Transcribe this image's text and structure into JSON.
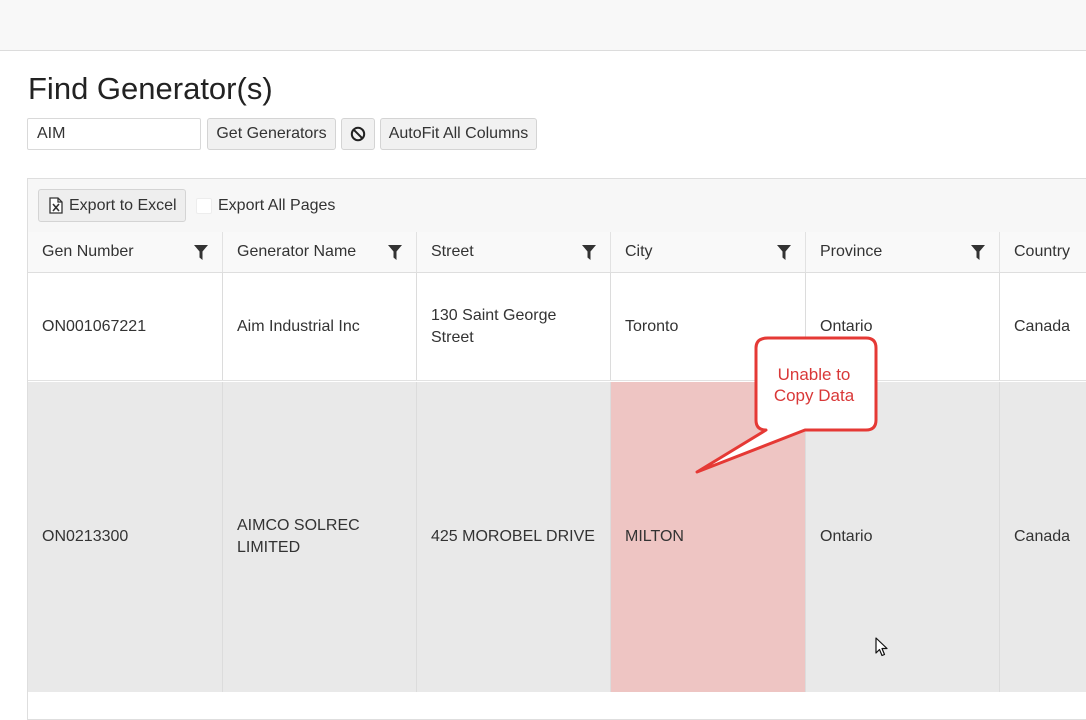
{
  "page": {
    "title": "Find Generator(s)"
  },
  "search": {
    "value": "AIM",
    "get_label": "Get Generators",
    "clear_icon": "ban-icon",
    "autofit_label": "AutoFit All Columns"
  },
  "toolbar": {
    "export_label": "Export to Excel",
    "export_icon": "excel-file-icon",
    "export_all_label": "Export All Pages",
    "export_all_checked": false
  },
  "table": {
    "columns": [
      "Gen Number",
      "Generator Name",
      "Street",
      "City",
      "Province",
      "Country"
    ],
    "filter_icon": "filter-funnel-icon",
    "rows": [
      [
        "ON001067221",
        "Aim Industrial Inc",
        "130 Saint George Street",
        "Toronto",
        "Ontario",
        "Canada"
      ],
      [
        "ON0213300",
        "AIMCO SOLREC LIMITED",
        "425 MOROBEL DRIVE",
        "MILTON",
        "Ontario",
        "Canada"
      ]
    ]
  },
  "annotation": {
    "text_line1": "Unable to",
    "text_line2": "Copy Data",
    "color": "#e53935"
  },
  "colors": {
    "highlight_cell": "#eec5c3",
    "selected_row": "#e9e9e9"
  }
}
